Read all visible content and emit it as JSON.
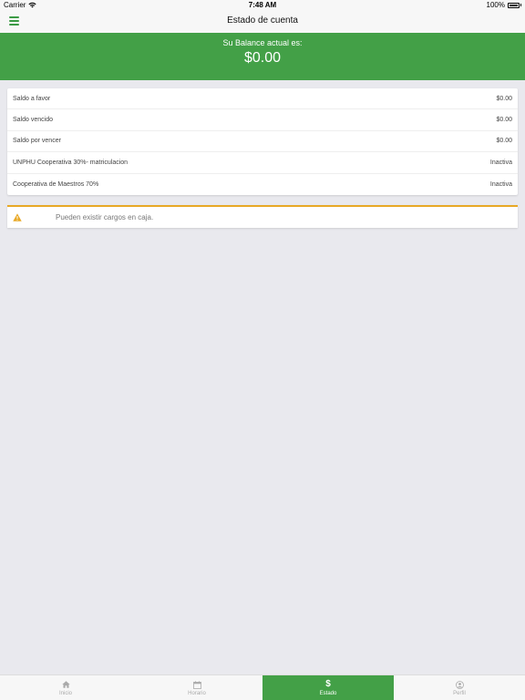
{
  "status_bar": {
    "carrier": "Carrier",
    "time": "7:48 AM",
    "battery": "100%"
  },
  "header": {
    "title": "Estado de cuenta"
  },
  "balance": {
    "label": "Su Balance actual es:",
    "amount": "$0.00"
  },
  "account_rows": [
    {
      "label": "Saldo a favor",
      "value": "$0.00"
    },
    {
      "label": "Saldo vencido",
      "value": "$0.00"
    },
    {
      "label": "Saldo por vencer",
      "value": "$0.00"
    },
    {
      "label": "UNPHU Cooperativa 30%- matriculacion",
      "value": "Inactiva"
    },
    {
      "label": "Cooperativa de Maestros 70%",
      "value": "Inactiva"
    }
  ],
  "alert": {
    "text": "Pueden existir cargos en caja.",
    "icon": "warning-icon"
  },
  "tabs": [
    {
      "label": "Inicio",
      "icon": "home-icon"
    },
    {
      "label": "Horario",
      "icon": "calendar-icon"
    },
    {
      "label": "Estado",
      "icon": "dollar-icon",
      "active": true
    },
    {
      "label": "Perfil",
      "icon": "profile-icon"
    }
  ],
  "colors": {
    "primary": "#43a047",
    "warning": "#e8a825",
    "background": "#e9e9ee"
  }
}
